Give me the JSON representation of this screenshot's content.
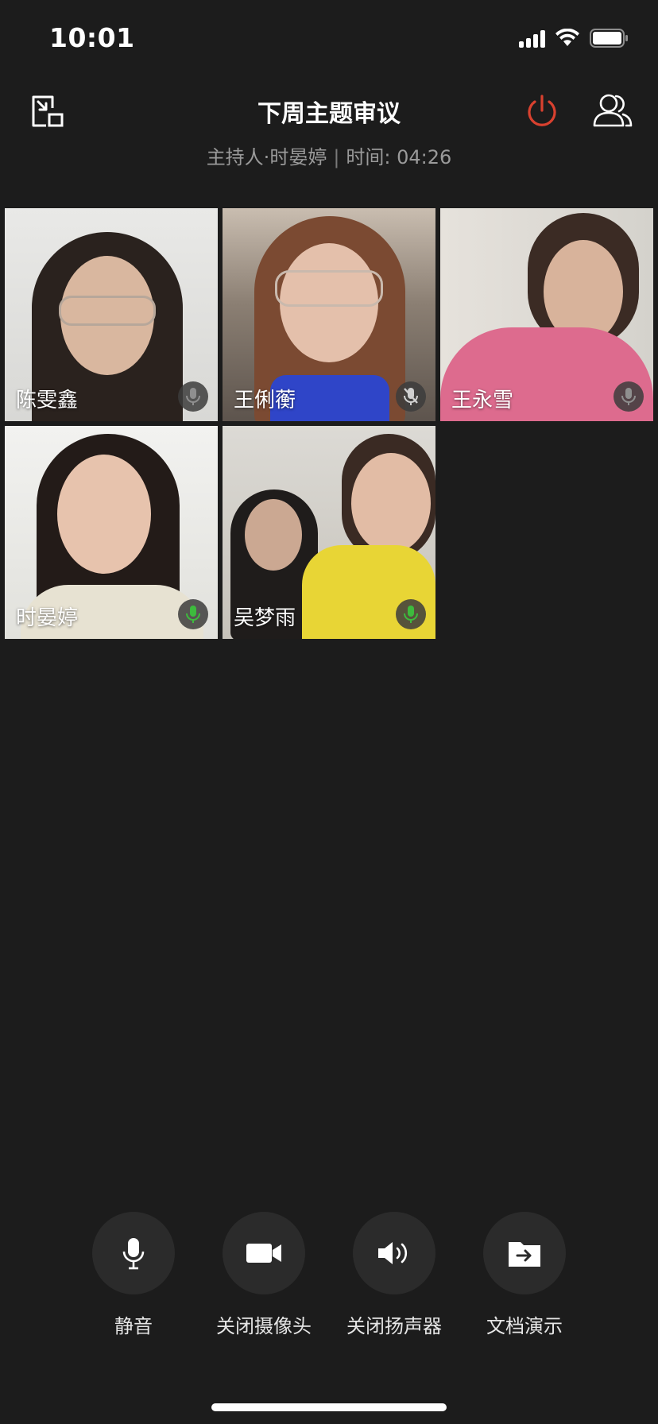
{
  "status_bar": {
    "time": "10:01"
  },
  "header": {
    "title": "下周主题审议",
    "host": "主持人·时晏婷",
    "separator": "|",
    "duration": "时间: 04:26"
  },
  "participants": [
    {
      "name": "陈雯鑫",
      "mic": "inactive"
    },
    {
      "name": "王俐蘅",
      "mic": "muted"
    },
    {
      "name": "王永雪",
      "mic": "inactive"
    },
    {
      "name": "时晏婷",
      "mic": "active"
    },
    {
      "name": "吴梦雨",
      "mic": "active"
    }
  ],
  "controls": [
    {
      "label": "静音",
      "icon": "microphone-icon"
    },
    {
      "label": "关闭摄像头",
      "icon": "video-camera-icon"
    },
    {
      "label": "关闭扬声器",
      "icon": "speaker-icon"
    },
    {
      "label": "文档演示",
      "icon": "share-document-icon"
    }
  ],
  "colors": {
    "background": "#1c1c1c",
    "end_meeting": "#d9412f",
    "mic_active": "#3dbb3d"
  }
}
